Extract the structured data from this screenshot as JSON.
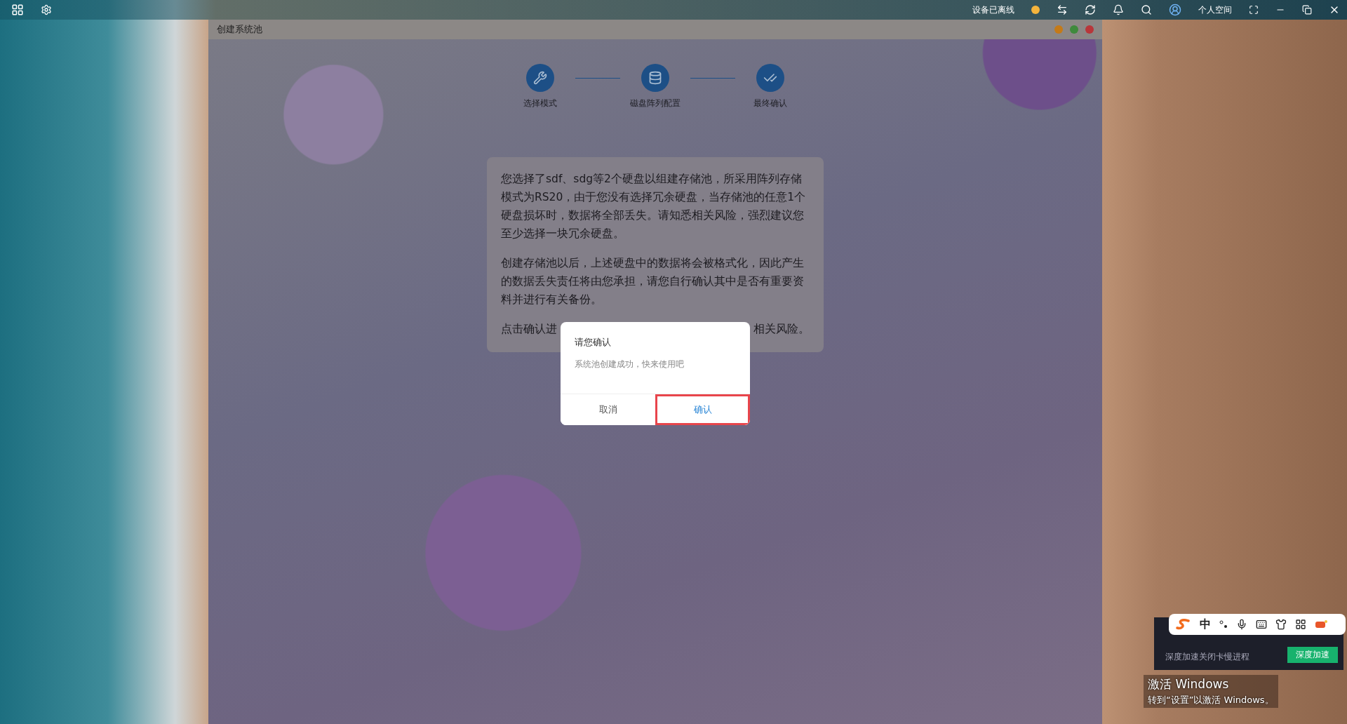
{
  "top_bar": {
    "status": "设备已离线",
    "user": "个人空间"
  },
  "window": {
    "title": "创建系统池",
    "steps": [
      {
        "kind": "tools",
        "label": "选择模式"
      },
      {
        "kind": "disk",
        "label": "磁盘阵列配置"
      },
      {
        "kind": "check",
        "label": "最终确认"
      }
    ],
    "card": {
      "paragraphs": [
        "您选择了sdf、sdg等2个硬盘以组建存储池，所采用阵列存储模式为RS20，由于您没有选择冗余硬盘，当存储池的任意1个硬盘损坏时，数据将全部丢失。请知悉相关风险，强烈建议您至少选择一块冗余硬盘。",
        "创建存储池以后，上述硬盘中的数据将会被格式化，因此产生的数据丢失责任将由您承担，请您自行确认其中是否有重要资料并进行有关备份。"
      ],
      "last_line": {
        "left": "点击确认进",
        "right": "相关风险。"
      }
    }
  },
  "dialog": {
    "title": "请您确认",
    "message": "系统池创建成功，快来使用吧",
    "buttons": [
      {
        "label": "取消",
        "selected": false
      },
      {
        "label": "确认",
        "selected": true
      }
    ]
  },
  "ime_toolbar": {
    "mode": "中"
  },
  "notification": {
    "message": "深度加速关闭卡慢进程",
    "button": "深度加速"
  },
  "activation_notice": {
    "title": "激活 Windows",
    "subtitle": "转到“设置”以激活 Windows。"
  }
}
